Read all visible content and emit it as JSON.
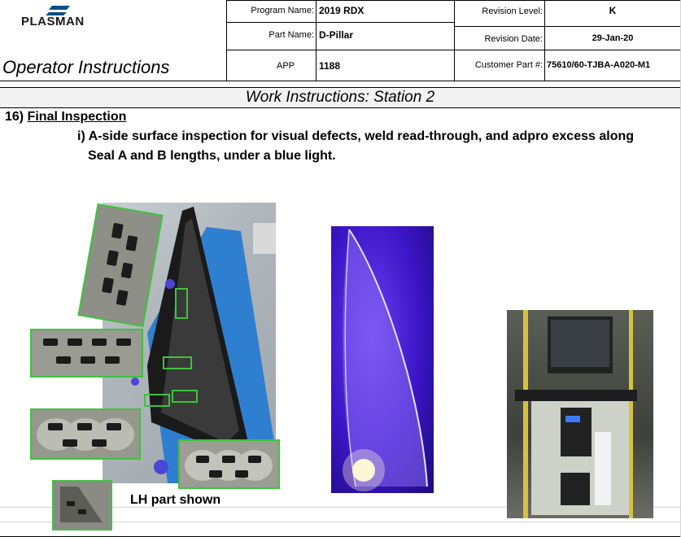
{
  "header": {
    "logo_text": "PLASMAN",
    "title": "Operator Instructions",
    "program_name_label": "Program Name:",
    "program_name_value": "2019 RDX",
    "part_name_label": "Part Name:",
    "part_name_value": "D-Pillar",
    "app_label": "APP",
    "app_value": "1188",
    "revision_level_label": "Revision Level:",
    "revision_level_value": "K",
    "revision_date_label": "Revision Date:",
    "revision_date_value": "29-Jan-20",
    "customer_part_label": "Customer Part #:",
    "customer_part_value": "75610/60-TJBA-A020-M1"
  },
  "section": {
    "banner": "Work Instructions: Station 2",
    "step_number": "16)",
    "step_title": "Final Inspection",
    "instruction_line1": "i) A-side surface inspection for visual defects, weld read-through, and adpro excess along",
    "instruction_line2": "Seal A and B lengths, under a blue light."
  },
  "images": {
    "caption": "LH part shown"
  },
  "colors": {
    "callout_green": "#3ec33e",
    "logo_blue": "#0b4f8a",
    "blue_light": "#4a1fd6"
  }
}
